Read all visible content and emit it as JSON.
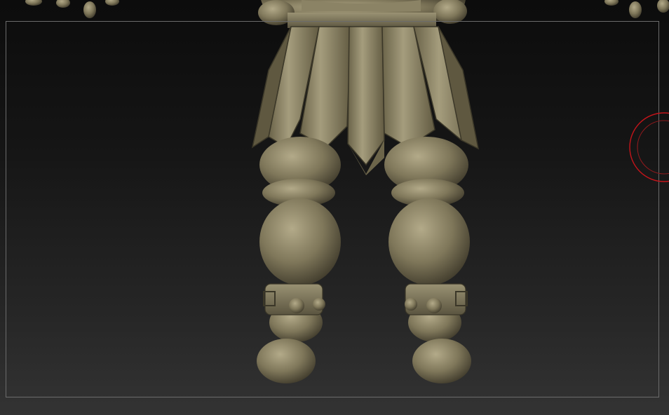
{
  "viewport": {
    "background_top": "#0c0c0c",
    "background_bottom": "#333333",
    "frame_color": "#6b6b6b"
  },
  "model": {
    "material_color": "#7d7457",
    "highlight_color": "#b0a786",
    "shadow_color": "#3e3a2b"
  },
  "brush_cursor": {
    "color": "#c4141a"
  }
}
